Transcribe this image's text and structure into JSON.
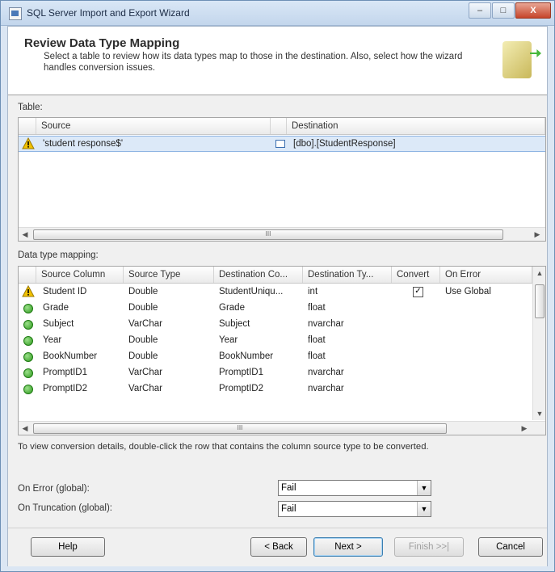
{
  "window": {
    "title": "SQL Server Import and Export Wizard",
    "buttons": [
      "–",
      "□",
      "X"
    ]
  },
  "header": {
    "title": "Review Data Type Mapping",
    "description": "Select a table to review how its data types map to those in the destination. Also, select how the wizard handles conversion issues."
  },
  "table_section": {
    "label": "Table:",
    "columns": [
      "Source",
      "Destination"
    ],
    "rows": [
      {
        "source": "'student response$'",
        "destination": "[dbo].[StudentResponse]"
      }
    ],
    "scroll_thumb": "III"
  },
  "mapping_section": {
    "label": "Data type mapping:",
    "columns": [
      "Source Column",
      "Source Type",
      "Destination Co...",
      "Destination Ty...",
      "Convert",
      "On Error"
    ],
    "rows": [
      {
        "status": "warning",
        "source_column": "Student ID",
        "source_type": "Double",
        "dest_column": "StudentUniqu...",
        "dest_type": "int",
        "convert": "✓",
        "on_error": "Use Global"
      },
      {
        "status": "ok",
        "source_column": "Grade",
        "source_type": "Double",
        "dest_column": "Grade",
        "dest_type": "float",
        "convert": "",
        "on_error": ""
      },
      {
        "status": "ok",
        "source_column": "Subject",
        "source_type": "VarChar",
        "dest_column": "Subject",
        "dest_type": "nvarchar",
        "convert": "",
        "on_error": ""
      },
      {
        "status": "ok",
        "source_column": "Year",
        "source_type": "Double",
        "dest_column": "Year",
        "dest_type": "float",
        "convert": "",
        "on_error": ""
      },
      {
        "status": "ok",
        "source_column": "BookNumber",
        "source_type": "Double",
        "dest_column": "BookNumber",
        "dest_type": "float",
        "convert": "",
        "on_error": ""
      },
      {
        "status": "ok",
        "source_column": "PromptID1",
        "source_type": "VarChar",
        "dest_column": "PromptID1",
        "dest_type": "nvarchar",
        "convert": "",
        "on_error": ""
      },
      {
        "status": "ok",
        "source_column": "PromptID2",
        "source_type": "VarChar",
        "dest_column": "PromptID2",
        "dest_type": "nvarchar",
        "convert": "",
        "on_error": ""
      }
    ],
    "scroll_thumb": "III"
  },
  "hint": "To view conversion details, double-click the row that contains the column source type to be converted.",
  "on_error_global": {
    "label": "On Error (global):",
    "value": "Fail"
  },
  "on_truncation_global": {
    "label": "On Truncation (global):",
    "value": "Fail"
  },
  "buttons": {
    "help": "Help",
    "back": "< Back",
    "next": "Next >",
    "finish": "Finish >>|",
    "cancel": "Cancel"
  },
  "colors": {
    "selection": "#dce9f8",
    "title_bar": "#c3d6ec",
    "ok_icon": "#2f9a1f",
    "warning_icon": "#f2c200"
  }
}
